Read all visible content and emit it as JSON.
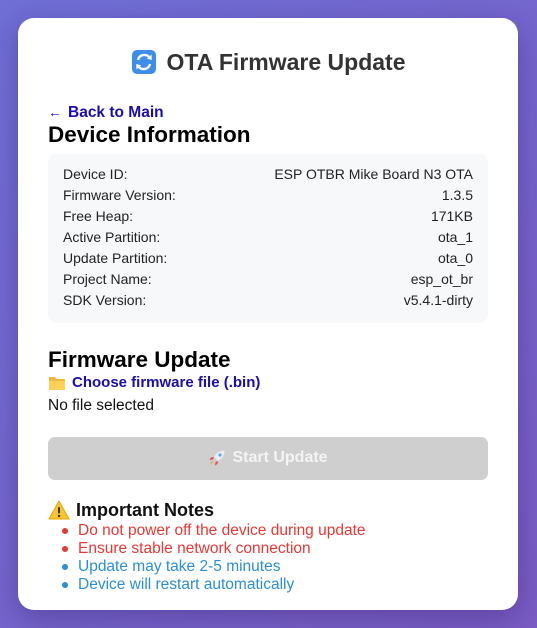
{
  "header": {
    "title": "OTA Firmware Update",
    "icon": "refresh-arrows-icon"
  },
  "nav": {
    "back_arrow": "←",
    "back_label": "Back to Main"
  },
  "device_info": {
    "heading": "Device Information",
    "rows": [
      {
        "label": "Device ID:",
        "value": "ESP OTBR Mike Board N3 OTA"
      },
      {
        "label": "Firmware Version:",
        "value": "1.3.5"
      },
      {
        "label": "Free Heap:",
        "value": "171KB"
      },
      {
        "label": "Active Partition:",
        "value": "ota_1"
      },
      {
        "label": "Update Partition:",
        "value": "ota_0"
      },
      {
        "label": "Project Name:",
        "value": "esp_ot_br"
      },
      {
        "label": "SDK Version:",
        "value": "v5.4.1-dirty"
      }
    ]
  },
  "firmware_update": {
    "heading": "Firmware Update",
    "choose_label": "Choose firmware file (.bin)",
    "choose_icon": "folder-icon",
    "file_status": "No file selected",
    "start_label": "Start Update",
    "start_icon": "rocket-icon",
    "start_enabled": false
  },
  "notes": {
    "heading": "Important Notes",
    "icon": "warning-icon",
    "items": [
      {
        "text": "Do not power off the device during update",
        "color": "#e53935"
      },
      {
        "text": "Ensure stable network connection",
        "color": "#e53935"
      },
      {
        "text": "Update may take 2-5 minutes",
        "color": "#2b8fd6"
      },
      {
        "text": "Device will restart automatically",
        "color": "#2b8fd6"
      }
    ]
  },
  "colors": {
    "link": "#1a0dab",
    "warning": "#e53935",
    "info": "#2b8fd6",
    "button_disabled": "#cfcfcf"
  }
}
